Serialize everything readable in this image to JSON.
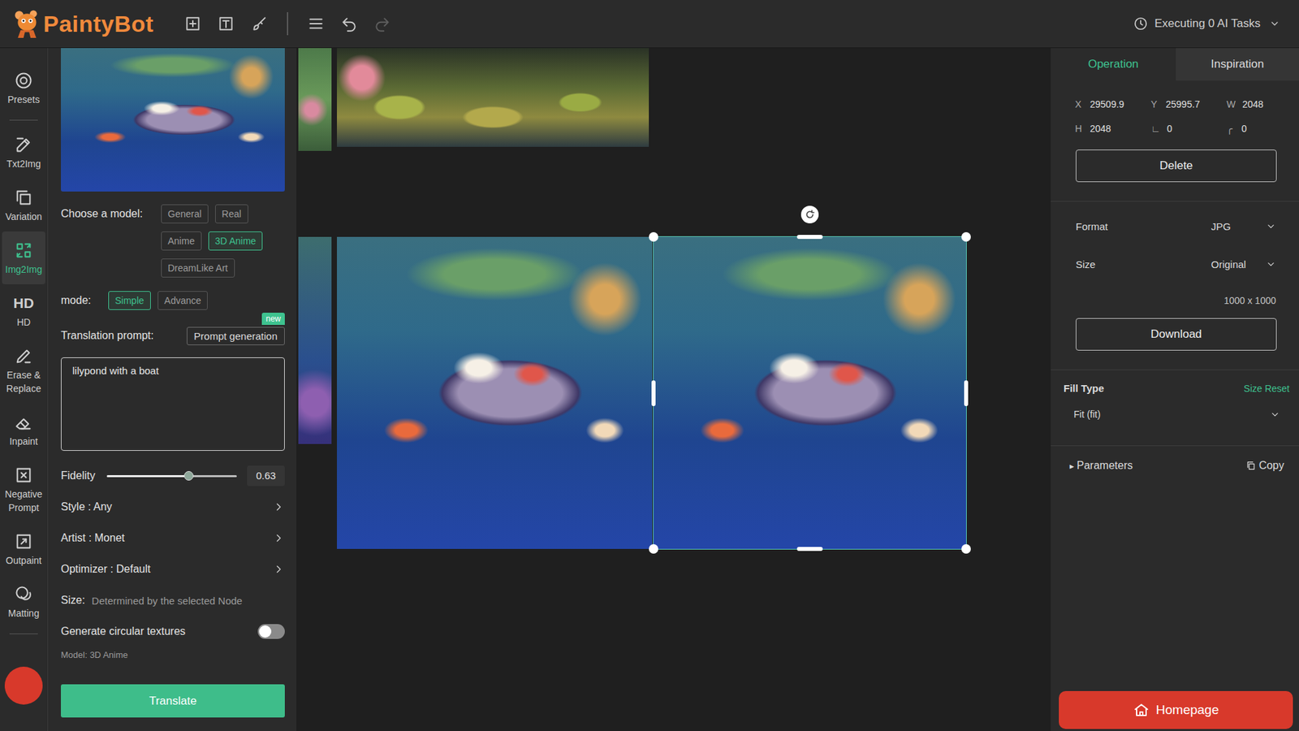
{
  "app": {
    "name": "PaintyBot"
  },
  "toolbar": {
    "undo": {
      "disabled": false
    },
    "redo": {
      "disabled": true
    }
  },
  "tasks": {
    "label": "Executing 0 AI Tasks"
  },
  "rail": [
    {
      "label": "Presets",
      "selected": false
    },
    {
      "label": "Txt2Img",
      "selected": false
    },
    {
      "label": "Variation",
      "selected": false
    },
    {
      "label": "Img2Img",
      "selected": true
    },
    {
      "label": "HD",
      "glyph": "HD",
      "selected": false
    },
    {
      "label": "Erase & Replace",
      "selected": false
    },
    {
      "label": "Inpaint",
      "selected": false
    },
    {
      "label": "Negative Prompt",
      "selected": false
    },
    {
      "label": "Outpaint",
      "selected": false
    },
    {
      "label": "Matting",
      "selected": false
    }
  ],
  "left_panel": {
    "model_label": "Choose a model:",
    "models": [
      {
        "label": "General",
        "selected": false
      },
      {
        "label": "Real",
        "selected": false
      },
      {
        "label": "Anime",
        "selected": false
      },
      {
        "label": "3D Anime",
        "selected": true
      },
      {
        "label": "DreamLike Art",
        "selected": false
      }
    ],
    "mode_label": "mode:",
    "modes": [
      {
        "label": "Simple",
        "selected": true
      },
      {
        "label": "Advance",
        "selected": false
      }
    ],
    "prompt_label": "Translation prompt:",
    "prompt_button": "Prompt generation",
    "prompt_badge": "new",
    "prompt": "lilypond with a boat",
    "fidelity": {
      "label": "Fidelity",
      "level": 0.63,
      "reading": "0.63"
    },
    "options": [
      "Style : Any",
      "Artist : Monet",
      "Optimizer : Default"
    ],
    "size": {
      "label": "Size:",
      "value": "Determined by the selected Node"
    },
    "circular": {
      "label": "Generate circular textures",
      "on": false
    },
    "model_info": "Model: 3D Anime",
    "translate": "Translate"
  },
  "canvas": {
    "images": [
      {
        "selected": false
      },
      {
        "selected": false
      },
      {
        "selected": false
      },
      {
        "selected": false
      },
      {
        "selected": true
      }
    ]
  },
  "right_panel": {
    "tabs": [
      {
        "label": "Operation",
        "selected": true
      },
      {
        "label": "Inspiration",
        "selected": false
      }
    ],
    "fields": [
      {
        "label": "X",
        "value": "29509.9"
      },
      {
        "label": "Y",
        "value": "25995.7"
      },
      {
        "label": "W",
        "value": "2048"
      },
      {
        "label": "H",
        "value": "2048"
      },
      {
        "label": "∟",
        "value": "0"
      },
      {
        "label": "╭",
        "value": "0"
      }
    ],
    "delete": "Delete",
    "format": {
      "label": "Format",
      "value": "JPG"
    },
    "size": {
      "label": "Size",
      "value": "Original",
      "dims": "1000 x 1000"
    },
    "download": "Download",
    "fill": {
      "label": "Fill Type",
      "reset": "Size Reset",
      "value": "Fit (fit)"
    },
    "parameters": {
      "marker": "▸",
      "label": "Parameters",
      "expanded": false,
      "copy": "Copy"
    },
    "homepage": "Homepage"
  }
}
